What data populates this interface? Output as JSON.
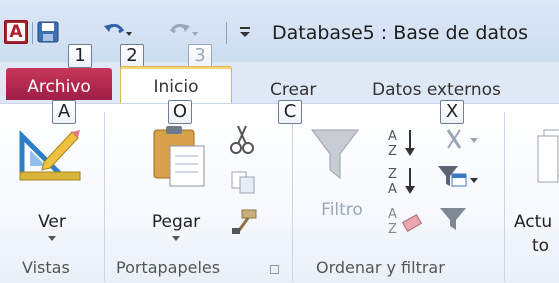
{
  "window": {
    "app_icon_letter": "A",
    "title": "Database5 : Base de datos"
  },
  "quick_access": {
    "keytips": [
      "1",
      "2",
      "3"
    ]
  },
  "tabs": {
    "archivo": {
      "label": "Archivo",
      "keytip": "A"
    },
    "inicio": {
      "label": "Inicio",
      "keytip": "O"
    },
    "crear": {
      "label": "Crear",
      "keytip": "C"
    },
    "datos_externos": {
      "label": "Datos externos",
      "keytip": "X"
    }
  },
  "ribbon": {
    "ver_label": "Ver",
    "pegar_label": "Pegar",
    "filtro_label": "Filtro",
    "actualizar_label_line1": "Actu",
    "actualizar_label_line2": "to",
    "groups": {
      "vistas": "Vistas",
      "portapapeles": "Portapapeles",
      "ordenar": "Ordenar y filtrar"
    }
  },
  "colors": {
    "archivo_tab": "#b0264e",
    "inicio_tab_border": "#e0b84c",
    "ribbon_bg": "#ffffff",
    "title_bg": "#cddcf0"
  },
  "icons": [
    "app-access-icon",
    "save-icon",
    "undo-icon",
    "redo-icon",
    "customize-qat-icon",
    "view-icon",
    "paste-icon",
    "cut-icon",
    "copy-icon",
    "format-painter-icon",
    "filter-icon",
    "sort-ascending-icon",
    "sort-descending-icon",
    "remove-sort-icon",
    "selection-icon",
    "advanced-filter-icon",
    "toggle-filter-icon",
    "refresh-icon"
  ]
}
